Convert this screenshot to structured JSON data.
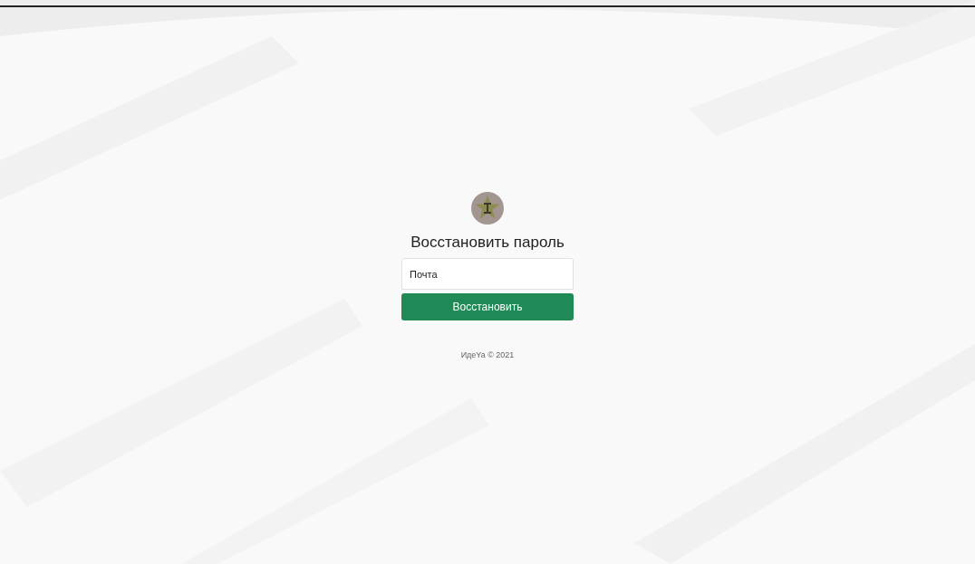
{
  "form": {
    "title": "Восстановить пароль",
    "email": {
      "placeholder": "Почта"
    },
    "submit": "Восстановить"
  },
  "footer": {
    "text": "ИдеYa © 2021"
  }
}
